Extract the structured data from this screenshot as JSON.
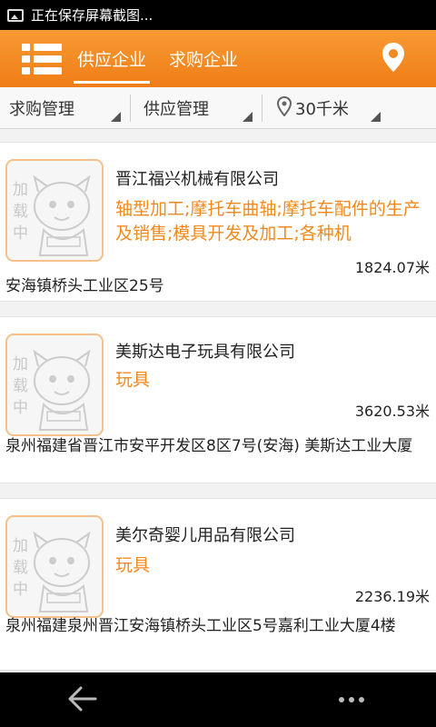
{
  "status_bar": {
    "notification": "正在保存屏幕截图..."
  },
  "header": {
    "tabs": [
      {
        "label": "供应企业",
        "active": true
      },
      {
        "label": "求购企业",
        "active": false
      }
    ],
    "accent_color": "#f28a23"
  },
  "filters": [
    {
      "label": "求购管理"
    },
    {
      "label": "供应管理"
    },
    {
      "label": "30千米",
      "icon": "location-pin-icon"
    }
  ],
  "listings": [
    {
      "thumbnail_text": "加载中",
      "company": "晋江福兴机械有限公司",
      "products": "轴型加工;摩托车曲轴;摩托车配件的生产及销售;模具开发及加工;各种机",
      "distance": "1824.07米",
      "address": "安海镇桥头工业区25号"
    },
    {
      "thumbnail_text": "加载中",
      "company": "美斯达电子玩具有限公司",
      "products": "玩具",
      "distance": "3620.53米",
      "address": "泉州福建省晋江市安平开发区8区7号(安海) 美斯达工业大厦"
    },
    {
      "thumbnail_text": "加载中",
      "company": "美尔奇婴儿用品有限公司",
      "products": "玩具",
      "distance": "2236.19米",
      "address": "泉州福建泉州晋江安海镇桥头工业区5号嘉利工业大厦4楼"
    }
  ],
  "nav": {
    "back_icon": "back-arrow-icon",
    "more_icon": "more-dots-icon"
  }
}
